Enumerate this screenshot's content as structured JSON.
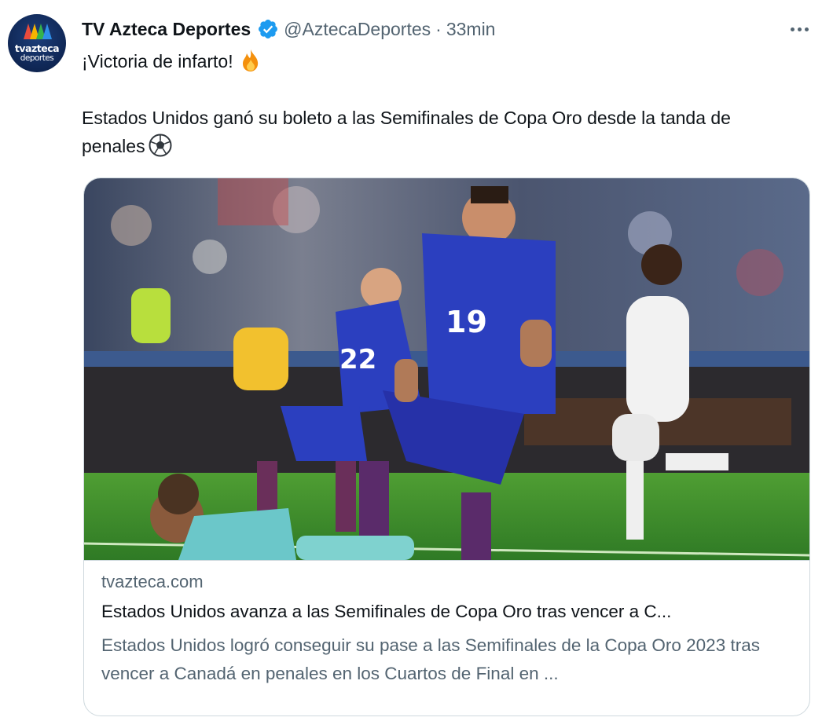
{
  "author": {
    "name": "TV Azteca Deportes",
    "handle": "@AztecaDeportes",
    "separator": "·",
    "time": "33min",
    "avatar_text_top": "tvazteca",
    "avatar_text_bottom": "deportes",
    "verified_color": "#1d9bf0"
  },
  "tweet": {
    "line1": "¡Victoria de infarto!",
    "line1_emoji": "fire-emoji",
    "line2": "Estados Unidos ganó su boleto a las Semifinales de Copa Oro desde la tanda de penales",
    "line2_emoji": "soccer-ball-emoji"
  },
  "more_icon": "more-horizontal-icon",
  "card": {
    "domain": "tvazteca.com",
    "title": "Estados Unidos avanza a las Semifinales de Copa Oro tras vencer a C...",
    "description": "Estados Unidos logró conseguir su pase a las Semifinales de la Copa Oro 2023 tras vencer a Canadá en penales en los Cuartos de Final en ...",
    "image_jersey_numbers": [
      "19",
      "22"
    ]
  },
  "colors": {
    "text_primary": "#0f1419",
    "text_secondary": "#536471",
    "border": "#cfd9de",
    "jersey_blue": "#2b3fbf",
    "pitch_green": "#3f8f2e"
  }
}
